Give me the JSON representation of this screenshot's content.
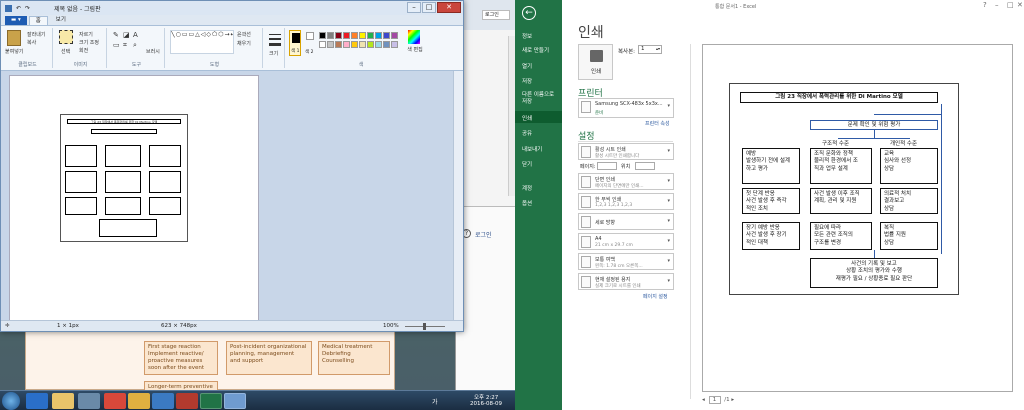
{
  "paint": {
    "title": "제목 없음 - 그림판",
    "tabs": [
      "홈",
      "보기"
    ],
    "groups": [
      "클립보드",
      "이미지",
      "도구",
      "도형",
      "색"
    ],
    "clipboard": {
      "paste": "붙여넣기",
      "cut": "잘라내기",
      "copy": "복사"
    },
    "image": {
      "select": "선택",
      "crop": "자르기",
      "resize": "크기 조정",
      "rotate": "회전"
    },
    "tools": {
      "brushes": "브러시"
    },
    "shapes": {
      "outline": "윤곽선",
      "fill": "채우기"
    },
    "size": "크기",
    "colors": {
      "color1": "색 1",
      "color2": "색 2",
      "edit": "색 편집"
    },
    "status": {
      "pixel": "1 × 1px",
      "size": "623 × 748px",
      "zoom": "100%"
    },
    "palette": [
      "#000000",
      "#7f7f7f",
      "#880015",
      "#ed1c24",
      "#ff7f27",
      "#fff200",
      "#22b14c",
      "#00a2e8",
      "#3f48cc",
      "#a349a4",
      "#ffffff",
      "#c3c3c3",
      "#b97a57",
      "#ffaec9",
      "#ffc90e",
      "#efe4b0",
      "#b5e61d",
      "#99d9ea",
      "#7092be",
      "#c8bfe7"
    ]
  },
  "bg_browser": {
    "login": "로그인",
    "login2": "로그인",
    "tab": "로그인"
  },
  "lower_doc": {
    "box1": "First stage reaction\nImplement reactive/\nproactive measures\nsoon after the event",
    "box2": "Post-incident organizational\nplanning, management\nand support",
    "box3": "Medical treatment\nDebriefing\nCounselling",
    "box4": "Longer-term preventive"
  },
  "taskbar": {
    "time": "오후 2:27",
    "date": "2016-08-09",
    "lang": "가"
  },
  "excel": {
    "top_title": "통합 문서1 - Excel",
    "nav": [
      "정보",
      "새로 만들기",
      "열기",
      "저장",
      "다른 이름으로 저장",
      "인쇄",
      "공유",
      "내보내기",
      "닫기",
      "계정",
      "옵션"
    ],
    "page_title": "인쇄",
    "print_button": "인쇄",
    "copies_label": "복사본:",
    "copies_value": "1",
    "printer_section": "프린터",
    "printer_name": "Samsung SCX-483x 5x3x...",
    "printer_status": "준비",
    "printer_props": "프린터 속성",
    "settings_section": "설정",
    "options": [
      {
        "t1": "활성 시트 인쇄",
        "t2": "활성 시트만 인쇄합니다"
      },
      {
        "t1": "단면 인쇄",
        "t2": "페이지의 단면에만 인쇄..."
      },
      {
        "t1": "한 부씩 인쇄",
        "t2": "1,2,3    1,2,3    1,2,3"
      },
      {
        "t1": "세로 방향",
        "t2": ""
      },
      {
        "t1": "A4",
        "t2": "21 cm x 29.7 cm"
      },
      {
        "t1": "보통 여백",
        "t2": "왼쪽: 1.78 cm    오른쪽..."
      },
      {
        "t1": "현재 설정된 용지",
        "t2": "실제 크기로 시트를 인쇄"
      }
    ],
    "pages_label": "페이지:",
    "to_label": "위치",
    "page_setup": "페이지 설정",
    "page_nav": {
      "current": "1",
      "total": "/1"
    }
  },
  "flowchart": {
    "title": "그림 23 직장에서 폭력관리를 위한 Di Martino 모델",
    "top": "문제 확인 및 위험 평가",
    "org_label": "구조적 수준",
    "ind_label": "개인적 수준",
    "left1": "예방\n발생하기 전에 설계\n하고 평가",
    "mid1": "조직 문화와 정책\n물리적 환경에서 조\n직과 업무 설계",
    "right1": "교육\n심사와 선정\n상담",
    "left2": "첫 단계 반응\n사건 발생 후 즉각\n적인 조치",
    "mid2": "사건 발생 이후 조직\n계획, 관리 및 지원",
    "right2": "의료적 처치\n결과보고\n상담",
    "left3": "장기 예방 반응\n사건 발생 후 장기\n적인 대책",
    "mid3": "필요에 따라\n모든 관련 조직의\n구조를 변경",
    "right3": "복직\n법률 지원\n상담",
    "bottom": "사건의 기록 및 보고\n상황 조치의 평가와 수행\n재평가 필요 / 상황종료 필요 판단"
  }
}
